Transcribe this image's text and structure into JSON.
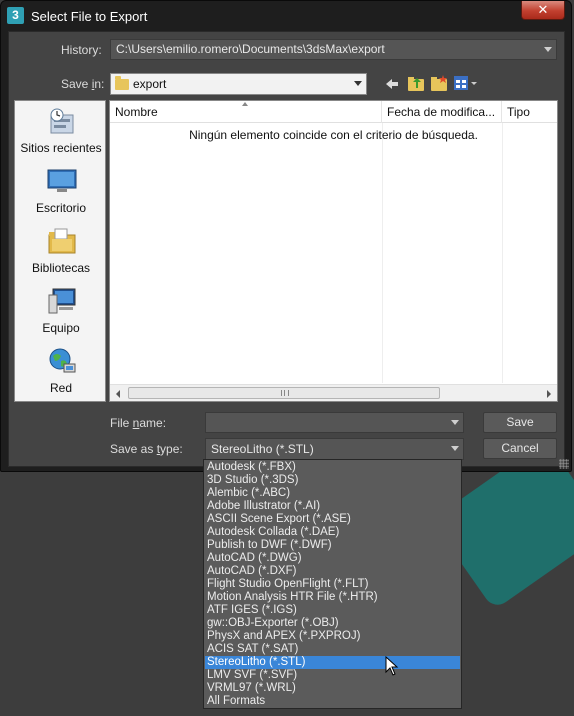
{
  "window": {
    "title": "Select File to Export",
    "app_icon": "3",
    "close_symbol": "✕"
  },
  "history": {
    "label": "History:",
    "value": "C:\\Users\\emilio.romero\\Documents\\3dsMax\\export"
  },
  "save_in": {
    "label": "Save in:",
    "value": "export"
  },
  "places": [
    {
      "label": "Sitios recientes",
      "icon": "recent-places-icon"
    },
    {
      "label": "Escritorio",
      "icon": "desktop-icon"
    },
    {
      "label": "Bibliotecas",
      "icon": "libraries-icon"
    },
    {
      "label": "Equipo",
      "icon": "computer-icon"
    },
    {
      "label": "Red",
      "icon": "network-icon"
    }
  ],
  "file_list": {
    "columns": [
      "Nombre",
      "Fecha de modifica...",
      "Tipo"
    ],
    "empty_message": "Ningún elemento coincide con el criterio de búsqueda."
  },
  "file_name": {
    "label": "File name:",
    "value": ""
  },
  "save_as_type": {
    "label": "Save as type:",
    "value": "StereoLitho (*.STL)"
  },
  "buttons": {
    "save": "Save",
    "cancel": "Cancel"
  },
  "type_options": [
    "Autodesk (*.FBX)",
    "3D Studio (*.3DS)",
    "Alembic (*.ABC)",
    "Adobe Illustrator (*.AI)",
    "ASCII Scene Export (*.ASE)",
    "Autodesk Collada (*.DAE)",
    "Publish to DWF (*.DWF)",
    "AutoCAD (*.DWG)",
    "AutoCAD (*.DXF)",
    "Flight Studio OpenFlight (*.FLT)",
    "Motion Analysis HTR File (*.HTR)",
    "ATF IGES (*.IGS)",
    "gw::OBJ-Exporter (*.OBJ)",
    "PhysX and APEX (*.PXPROJ)",
    "ACIS SAT (*.SAT)",
    "StereoLitho (*.STL)",
    "LMV SVF (*.SVF)",
    "VRML97 (*.WRL)",
    "All Formats"
  ],
  "selected_type_index": 15,
  "colors": {
    "selection": "#3a86d8",
    "dialog_bg": "#444444",
    "accent_teal": "#1f6f6b"
  }
}
